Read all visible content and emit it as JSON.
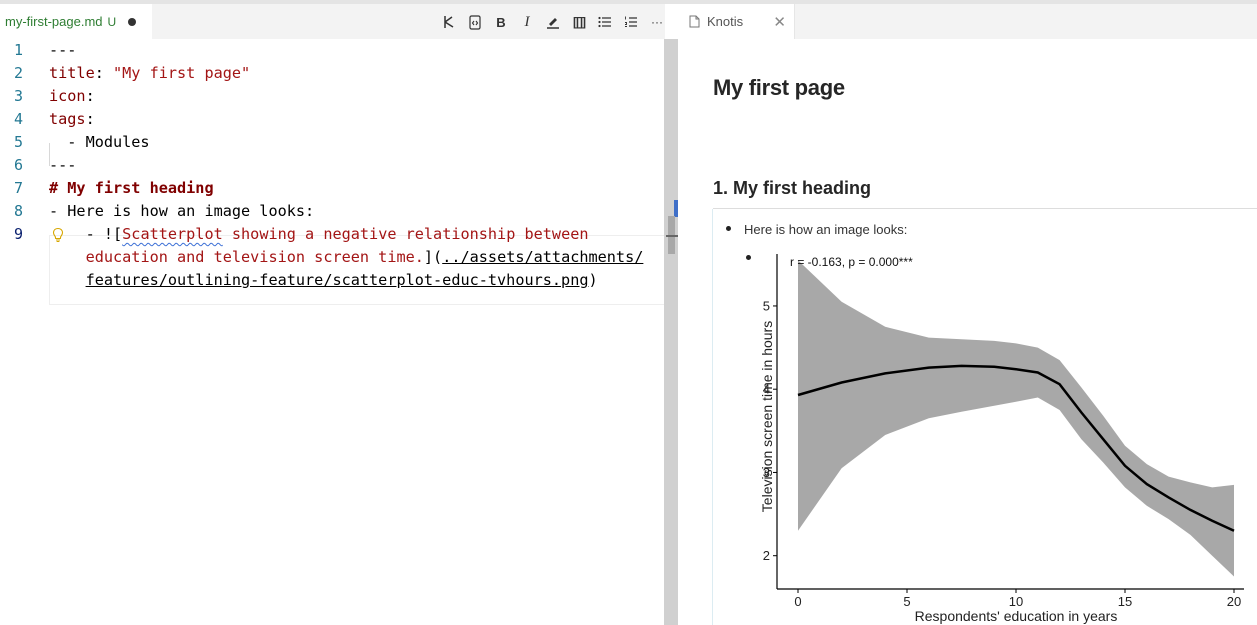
{
  "editor": {
    "tab": {
      "filename": "my-first-page.md",
      "status": "U"
    },
    "toolbar": [
      {
        "name": "outline-icon"
      },
      {
        "name": "code-block-icon"
      },
      {
        "name": "bold-icon",
        "glyph": "B"
      },
      {
        "name": "italic-icon",
        "glyph": "I"
      },
      {
        "name": "highlight-icon"
      },
      {
        "name": "wikilink-icon",
        "glyph": "[[]]"
      },
      {
        "name": "bullet-list-icon"
      },
      {
        "name": "numbered-list-icon"
      },
      {
        "name": "more-icon",
        "glyph": "···"
      }
    ],
    "lines": [
      {
        "num": "1",
        "tokens": [
          [
            "---",
            "punct"
          ]
        ]
      },
      {
        "num": "2",
        "tokens": [
          [
            "title",
            "key"
          ],
          [
            ": ",
            "punct"
          ],
          [
            "\"My first page\"",
            "str"
          ]
        ]
      },
      {
        "num": "3",
        "tokens": [
          [
            "icon",
            "key"
          ],
          [
            ":",
            "punct"
          ]
        ]
      },
      {
        "num": "4",
        "tokens": [
          [
            "tags",
            "key"
          ],
          [
            ":",
            "punct"
          ]
        ]
      },
      {
        "num": "5",
        "tokens": [
          [
            "  - Modules",
            "punct"
          ]
        ]
      },
      {
        "num": "6",
        "tokens": [
          [
            "---",
            "punct"
          ]
        ]
      },
      {
        "num": "7",
        "tokens": [
          [
            "# My first heading",
            "head"
          ]
        ]
      },
      {
        "num": "8",
        "tokens": [
          [
            "- Here is how an image looks:",
            "punct"
          ]
        ]
      },
      {
        "num": "9",
        "tokens": [
          [
            "    - ![",
            "punct"
          ],
          [
            "Scatterplot",
            "link-squiggle"
          ],
          [
            " showing a negative relationship between",
            "link"
          ]
        ]
      },
      {
        "num": "",
        "tokens": [
          [
            "    ",
            "punct"
          ],
          [
            "education and television screen time.",
            "link"
          ],
          [
            "](",
            "punct"
          ],
          [
            "../assets/attachments/",
            "url"
          ]
        ]
      },
      {
        "num": "",
        "tokens": [
          [
            "    ",
            "punct"
          ],
          [
            "features/outlining-feature/scatterplot-educ-tvhours.png",
            "url"
          ],
          [
            ")",
            "punct"
          ]
        ]
      }
    ]
  },
  "preview": {
    "tab_label": "Knotis",
    "page_title": "My first page",
    "heading": "1. My first heading",
    "list_item": "Here is how an image looks:"
  },
  "chart_data": {
    "type": "line",
    "title": "r = -0.163, p = 0.000***",
    "xlabel": "Respondents' education in years",
    "ylabel": "Television screen time in hours",
    "xlim": [
      0,
      20
    ],
    "ylim": [
      1.6,
      5.6
    ],
    "xticks": [
      0,
      5,
      10,
      15,
      20
    ],
    "yticks": [
      2,
      3,
      4,
      5
    ],
    "series": [
      {
        "x": [
          0,
          2,
          4,
          6,
          7.5,
          9,
          10,
          11,
          12,
          13,
          14,
          15,
          16,
          17,
          18,
          19,
          20
        ],
        "y": [
          3.93,
          4.08,
          4.19,
          4.26,
          4.28,
          4.27,
          4.24,
          4.2,
          4.06,
          3.72,
          3.4,
          3.08,
          2.86,
          2.7,
          2.55,
          2.42,
          2.3
        ],
        "lower": [
          2.3,
          3.05,
          3.45,
          3.65,
          3.73,
          3.8,
          3.85,
          3.9,
          3.75,
          3.4,
          3.12,
          2.82,
          2.6,
          2.44,
          2.25,
          2.0,
          1.75
        ],
        "upper": [
          5.55,
          5.05,
          4.75,
          4.62,
          4.6,
          4.58,
          4.55,
          4.5,
          4.35,
          4.02,
          3.68,
          3.32,
          3.1,
          2.95,
          2.88,
          2.82,
          2.85
        ]
      }
    ],
    "colors": {
      "line": "#000000",
      "band": "#a8a8a8"
    },
    "grid": false
  }
}
